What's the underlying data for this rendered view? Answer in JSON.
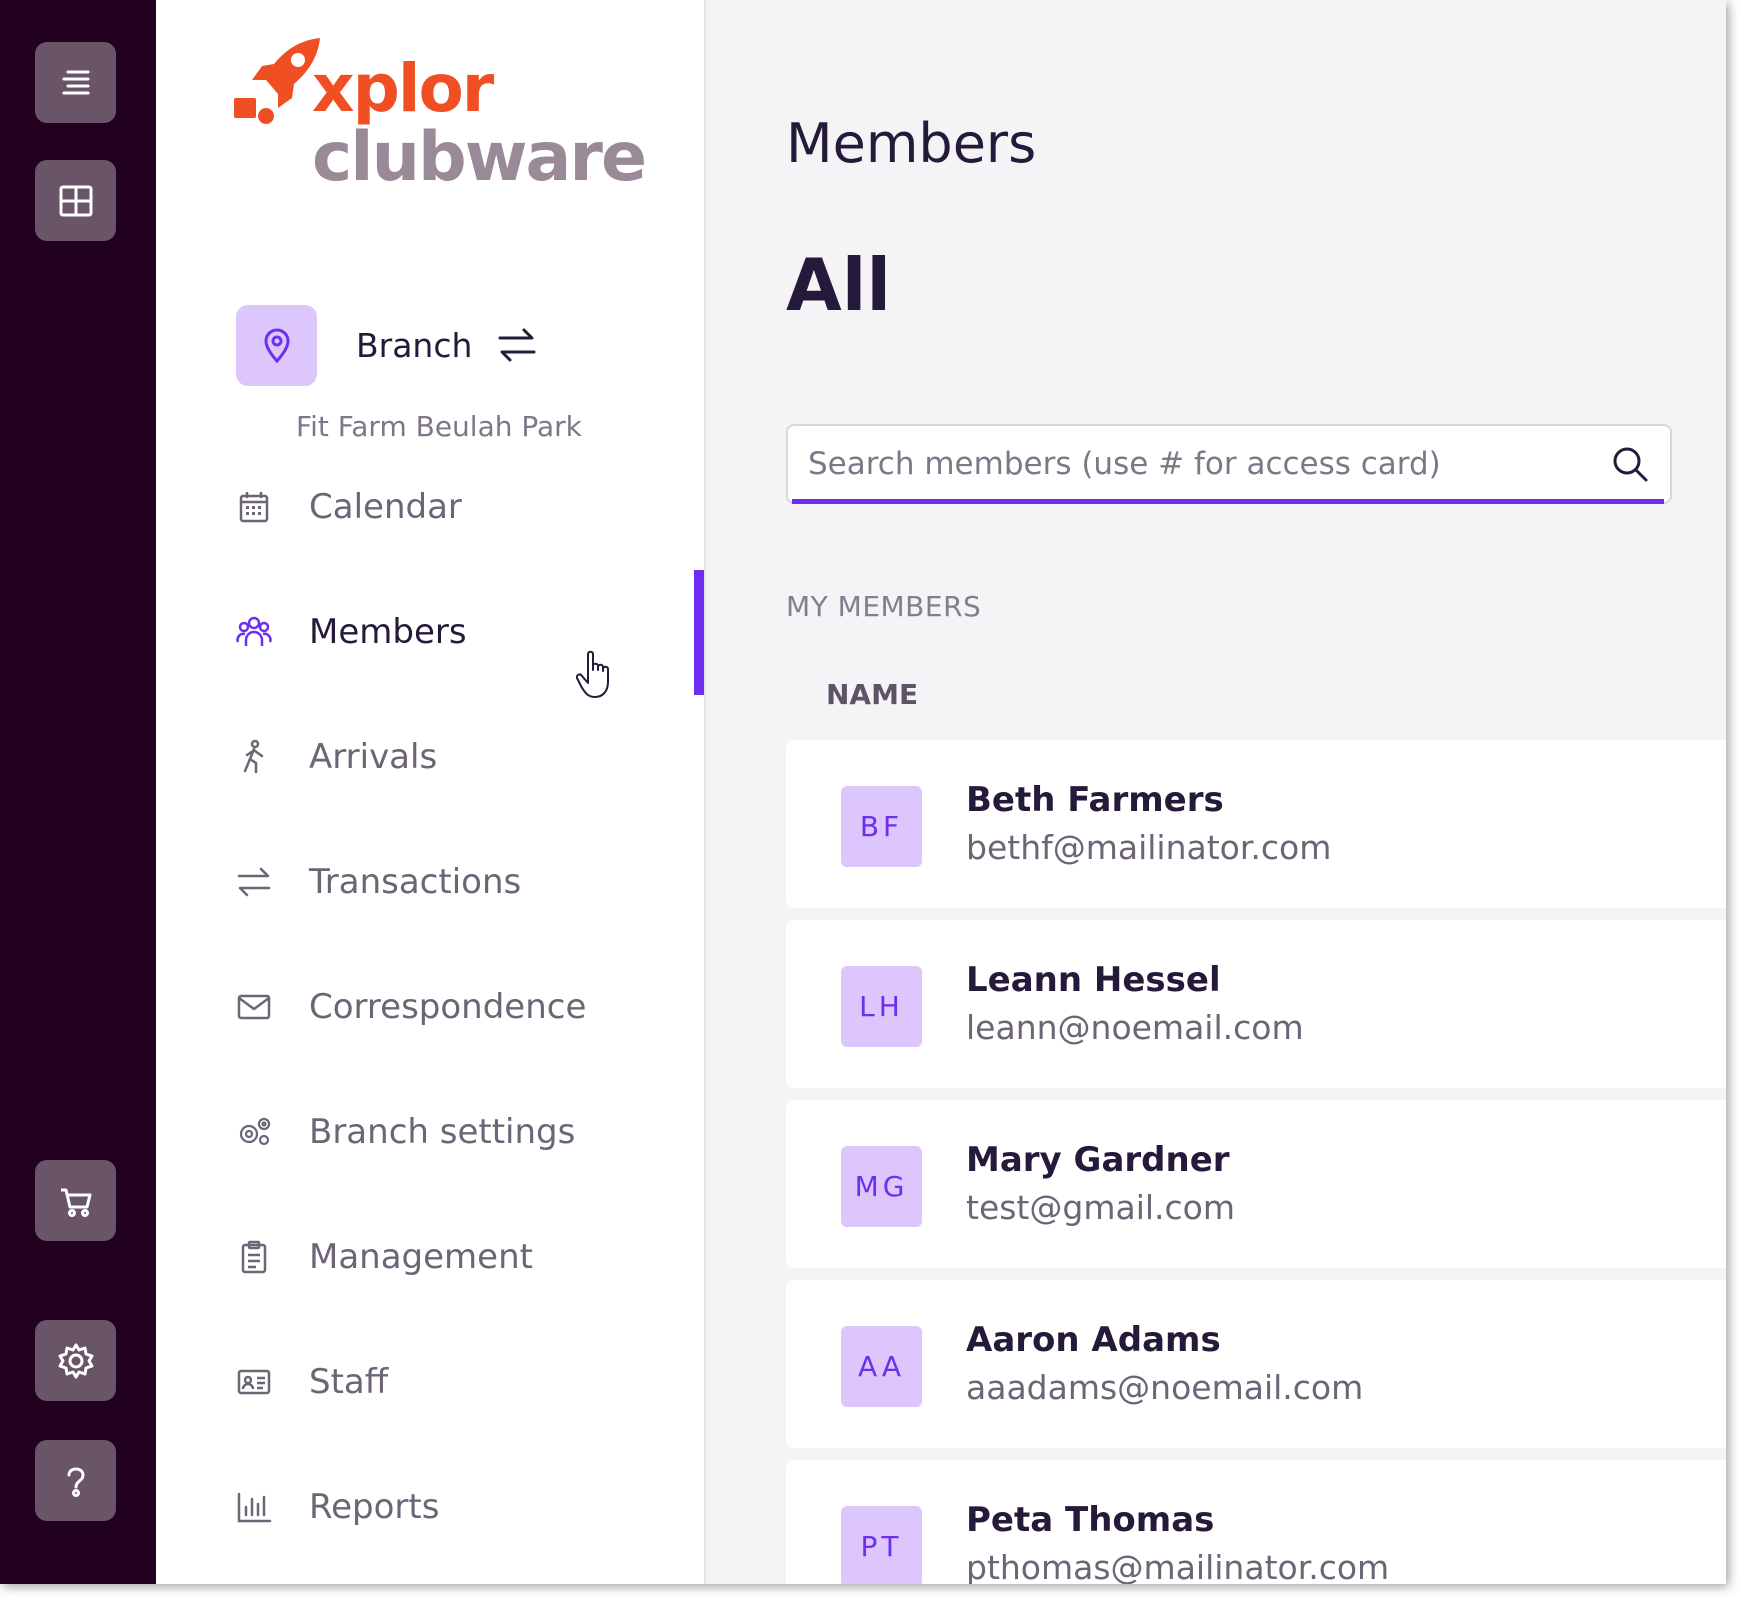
{
  "app": {
    "logo_top": "xplor",
    "logo_bottom": "clubware"
  },
  "colors": {
    "accent": "#6d2ef0",
    "rail": "#220020",
    "logo_orange": "#f04e23",
    "avatar_bg": "#dcc6fb"
  },
  "rail": {
    "icons": [
      "menu-icon",
      "grid-icon",
      "cart-icon",
      "gear-icon",
      "help-icon"
    ]
  },
  "branch": {
    "label": "Branch",
    "name": "Fit Farm Beulah Park"
  },
  "nav": {
    "items": [
      {
        "label": "Calendar",
        "icon": "calendar-icon"
      },
      {
        "label": "Members",
        "icon": "members-icon",
        "active": true
      },
      {
        "label": "Arrivals",
        "icon": "walking-person-icon"
      },
      {
        "label": "Transactions",
        "icon": "arrows-swap-icon"
      },
      {
        "label": "Correspondence",
        "icon": "envelope-icon"
      },
      {
        "label": "Branch settings",
        "icon": "gears-icon"
      },
      {
        "label": "Management",
        "icon": "clipboard-icon"
      },
      {
        "label": "Staff",
        "icon": "id-card-icon"
      },
      {
        "label": "Reports",
        "icon": "bar-chart-icon"
      }
    ]
  },
  "main": {
    "title": "Members",
    "subtitle": "All",
    "search_placeholder": "Search members (use # for access card)",
    "section_label": "MY MEMBERS",
    "column_name": "NAME",
    "members": [
      {
        "initials": "BF",
        "name": "Beth Farmers",
        "email": "bethf@mailinator.com"
      },
      {
        "initials": "LH",
        "name": "Leann Hessel",
        "email": "leann@noemail.com"
      },
      {
        "initials": "MG",
        "name": "Mary Gardner",
        "email": "test@gmail.com"
      },
      {
        "initials": "AA",
        "name": "Aaron Adams",
        "email": "aaadams@noemail.com"
      },
      {
        "initials": "PT",
        "name": "Peta Thomas",
        "email": "pthomas@mailinator.com"
      }
    ]
  }
}
